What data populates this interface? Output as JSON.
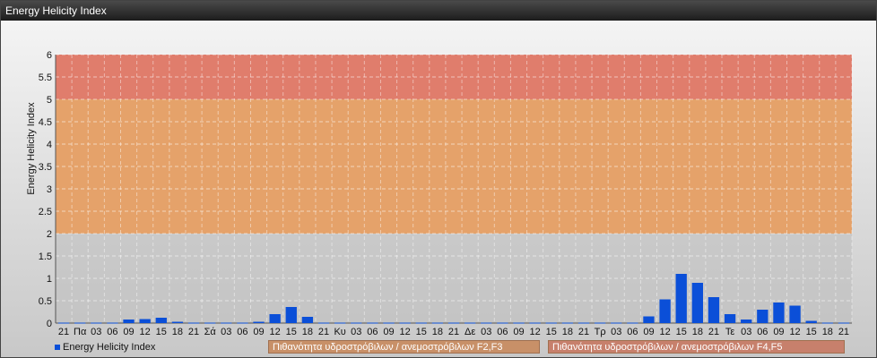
{
  "window": {
    "title": "Energy Helicity Index"
  },
  "legend": {
    "series_label": "Energy Helicity Index",
    "band1_label": "Πιθανότητα υδροστρόβιλων / ανεμοστρόβιλων F2,F3",
    "band2_label": "Πιθανότητα υδροστρόβιλων / ανεμοστρόβιλων F4,F5"
  },
  "colors": {
    "bar": "#0b4fd8",
    "band_low": "#d49a6a",
    "band_mid": "#e5a26a",
    "band_high": "#e07d6c"
  },
  "chart_data": {
    "type": "bar",
    "title": "",
    "xlabel": "",
    "ylabel": "Energy Helicity Index",
    "ylim": [
      0,
      6
    ],
    "yticks": [
      0,
      0.5,
      1,
      1.5,
      2,
      2.5,
      3,
      3.5,
      4,
      4.5,
      5,
      5.5,
      6
    ],
    "grid": true,
    "bands": [
      {
        "from": 2,
        "to": 5,
        "label": "Πιθανότητα υδροστρόβιλων / ανεμοστρόβιλων F2,F3"
      },
      {
        "from": 5,
        "to": 6,
        "label": "Πιθανότητα υδροστρόβιλων / ανεμοστρόβιλων F4,F5"
      }
    ],
    "categories": [
      "21",
      "Πα",
      "03",
      "06",
      "09",
      "12",
      "15",
      "18",
      "21",
      "Σά",
      "03",
      "06",
      "09",
      "12",
      "15",
      "18",
      "21",
      "Κυ",
      "03",
      "06",
      "09",
      "12",
      "15",
      "18",
      "21",
      "Δε",
      "03",
      "06",
      "09",
      "12",
      "15",
      "18",
      "21",
      "Τρ",
      "03",
      "06",
      "09",
      "12",
      "15",
      "18",
      "21",
      "Τε",
      "03",
      "06",
      "09",
      "12",
      "15",
      "18",
      "21"
    ],
    "series": [
      {
        "name": "Energy Helicity Index",
        "values": [
          0.01,
          0.01,
          0.01,
          0.01,
          0.08,
          0.09,
          0.12,
          0.03,
          0.01,
          0.01,
          0.01,
          0.01,
          0.03,
          0.2,
          0.36,
          0.14,
          0.01,
          0.01,
          0.01,
          0.01,
          0.01,
          0.01,
          0.01,
          0.01,
          0.01,
          0.01,
          0.01,
          0.01,
          0.01,
          0.01,
          0.01,
          0.01,
          0.01,
          0.01,
          0.01,
          0.01,
          0.15,
          0.53,
          1.1,
          0.9,
          0.58,
          0.2,
          0.08,
          0.3,
          0.46,
          0.39,
          0.05,
          0.01,
          0.01
        ]
      }
    ]
  }
}
